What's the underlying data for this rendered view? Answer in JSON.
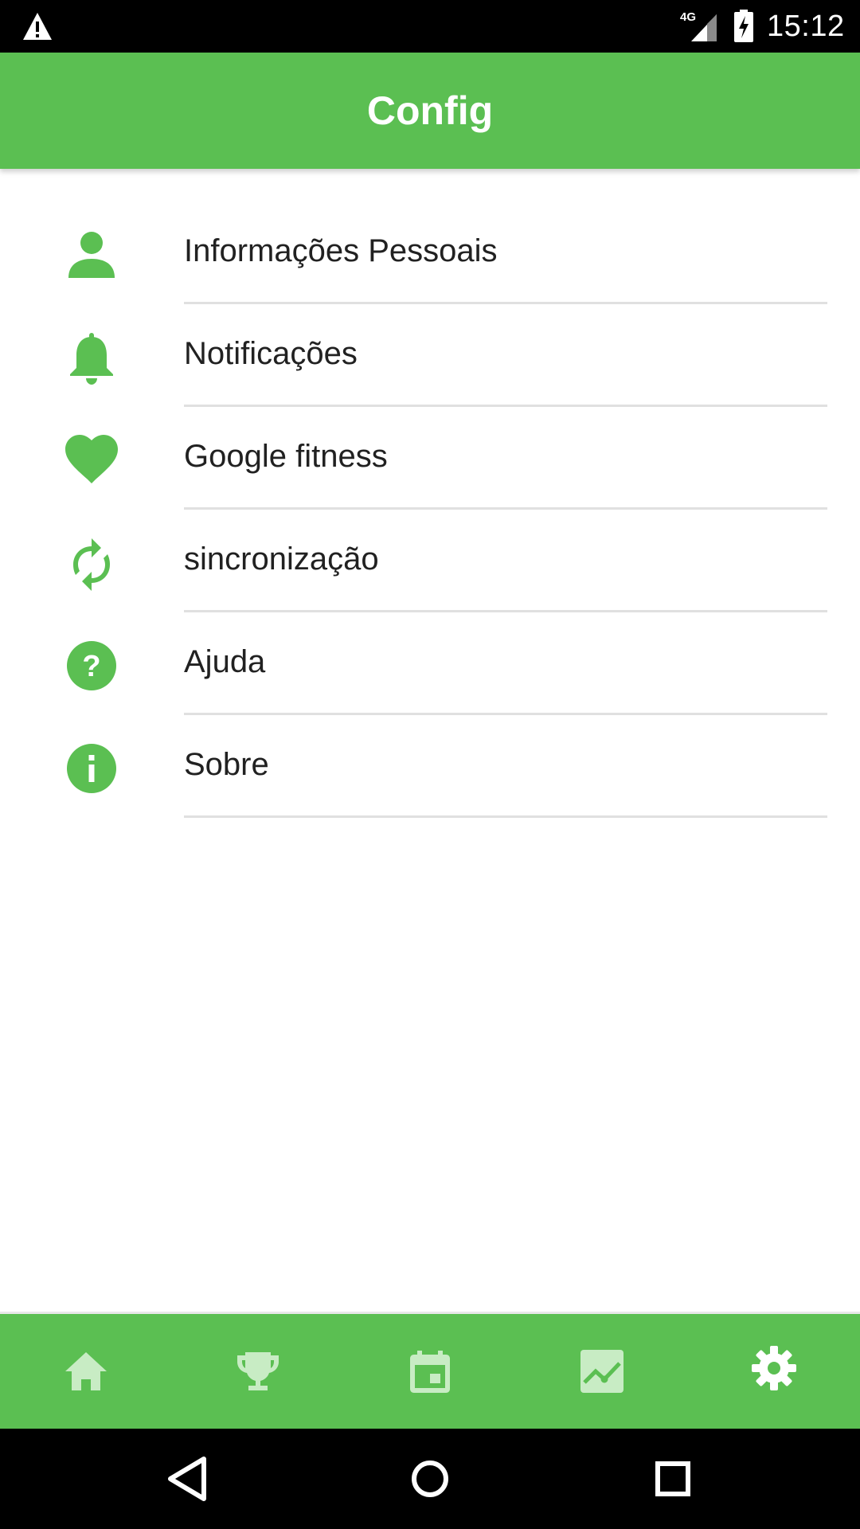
{
  "status_bar": {
    "network": "4G",
    "time": "15:12",
    "icons": [
      "warning-icon",
      "signal-icon",
      "battery-charging-icon"
    ]
  },
  "app_bar": {
    "title": "Config"
  },
  "settings": {
    "items": [
      {
        "label": "Informações Pessoais",
        "icon": "person-icon"
      },
      {
        "label": "Notificações",
        "icon": "bell-icon"
      },
      {
        "label": "Google fitness",
        "icon": "heart-icon"
      },
      {
        "label": "sincronização",
        "icon": "sync-icon"
      },
      {
        "label": "Ajuda",
        "icon": "help-circle-icon"
      },
      {
        "label": "Sobre",
        "icon": "info-circle-icon"
      }
    ]
  },
  "bottom_nav": {
    "items": [
      {
        "icon": "home-icon",
        "selected": false
      },
      {
        "icon": "trophy-icon",
        "selected": false
      },
      {
        "icon": "calendar-icon",
        "selected": false
      },
      {
        "icon": "chart-icon",
        "selected": false
      },
      {
        "icon": "gear-icon",
        "selected": true
      }
    ]
  },
  "system_nav": {
    "icons": [
      "back-icon",
      "home-circle-icon",
      "recents-icon"
    ]
  },
  "colors": {
    "primary": "#5bbf52",
    "icon_active": "#ffffff",
    "icon_inactive": "#c8ecc4",
    "text": "#212121",
    "divider": "#e0e0e0"
  }
}
